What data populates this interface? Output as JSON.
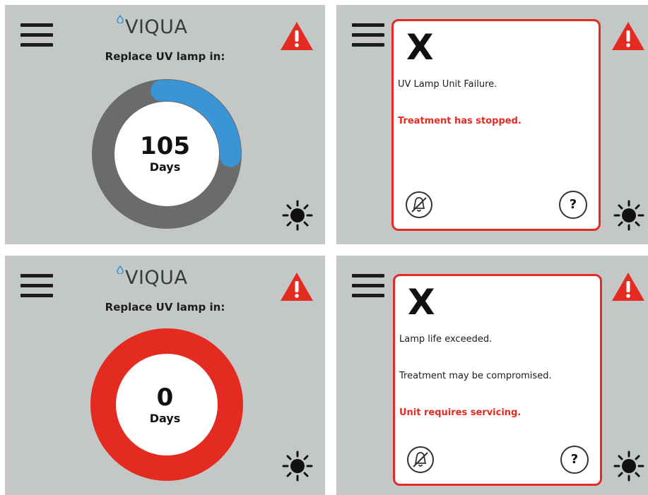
{
  "logo": {
    "text": "VIQUA"
  },
  "panels": {
    "lamp_105": {
      "subtitle": "Replace UV lamp in:",
      "count": "105",
      "unit": "Days",
      "remaining_fraction": 0.27
    },
    "unit_failure": {
      "x_mark": "X",
      "line1": "UV Lamp Unit Failure.",
      "line2": "Treatment has stopped.",
      "help": "?"
    },
    "lamp_0": {
      "subtitle": "Replace UV lamp in:",
      "count": "0",
      "unit": "Days",
      "remaining_fraction": 0
    },
    "life_exceeded": {
      "x_mark": "X",
      "line1": "Lamp life exceeded.",
      "line2": "Treatment may be compromised.",
      "line3": "Unit requires servicing.",
      "help": "?"
    }
  },
  "colors": {
    "panel_bg": "#c3c8c7",
    "progress_blue": "#3a95d6",
    "ring_gray": "#6b6b6b",
    "alert_red": "#e42b22"
  },
  "icons": {
    "menu": "hamburger-icon",
    "warning": "warning-triangle-icon",
    "brightness": "sun-icon",
    "mute": "bell-muted-icon",
    "help": "question-icon"
  }
}
